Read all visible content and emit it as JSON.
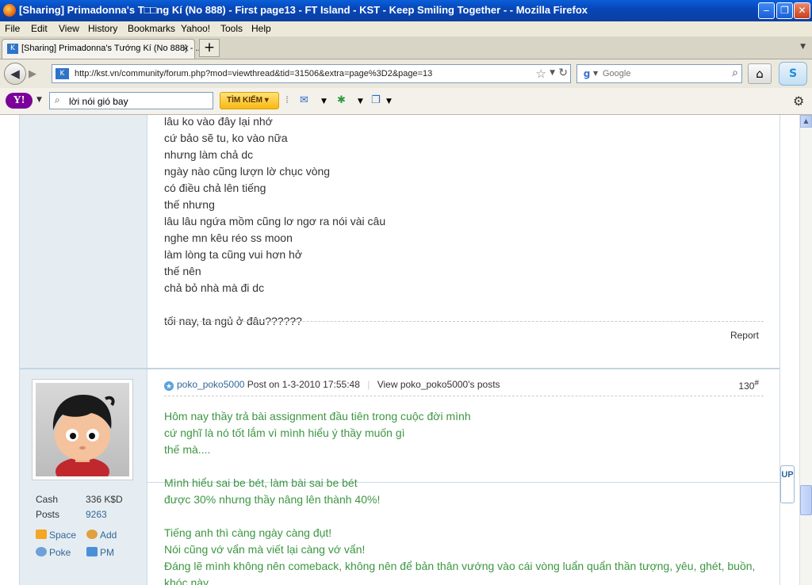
{
  "window": {
    "title": "[Sharing] Primadonna's T□□ng Kí (No 888) - First page13 - FT Island - KST - Keep Smiling Together - - Mozilla Firefox",
    "minimize": "‒",
    "restore": "❐",
    "close": "✕"
  },
  "menu": [
    "File",
    "Edit",
    "View",
    "History",
    "Bookmarks",
    "Yahoo!",
    "Tools",
    "Help"
  ],
  "tab": {
    "label": "[Sharing] Primadonna's Tướng Kí (No 888) - ...",
    "close": "×",
    "new_tab": "+"
  },
  "nav": {
    "url": "http://kst.vn/community/forum.php?mod=viewthread&tid=31506&extra=page%3D2&page=13",
    "search_placeholder": "Google"
  },
  "yahoo": {
    "logo": "Y!",
    "search_value": "lời nói gió bay",
    "search_button": "TÌM KIẾM ▾"
  },
  "post1": {
    "lines": [
      "lâu ko vào đây lại nhớ",
      "cứ bảo sẽ tu, ko vào nữa",
      "nhưng làm chả dc",
      "ngày nào cũng lượn lờ chục vòng",
      "có điều chả lên tiếng",
      "thế nhưng",
      "lâu lâu ngứa mồm cũng lơ ngơ ra nói vài câu",
      "nghe mn kêu réo ss moon",
      "làm lòng ta cũng vui hơn hở",
      "thế nên",
      "chả bỏ nhà mà đi dc",
      "",
      "tối nay, ta ngủ ở đâu??????"
    ],
    "report": "Report"
  },
  "post2": {
    "stats": [
      {
        "label": "Cash",
        "value": "336 K$D"
      },
      {
        "label": "Posts",
        "value": "9263"
      }
    ],
    "actions": {
      "space": "Space",
      "add": "Add",
      "poke": "Poke",
      "pm": "PM"
    },
    "author": "poko_poko5000",
    "posted": "Post on 1-3-2010 17:55:48",
    "view_posts": "View poko_poko5000's posts",
    "number": "130",
    "number_sup": "#",
    "lines": [
      "Hôm nay thầy trả bài assignment đầu tiên trong cuộc đời mình",
      "cứ nghĩ là nó tốt lắm vì mình hiểu ý thầy muốn gì",
      "thế mà....",
      "",
      "Mình hiểu sai be bét, làm bài sai be bét",
      "được 30% nhưng thầy nâng lên thành 40%!",
      "",
      "Tiếng anh thì càng ngày càng đụt!",
      "Nói cũng vớ vẩn mà viết lại càng vớ vẩn!",
      "Đáng lẽ mình không nên comeback, không nên để bản thân vướng vào cái vòng luẩn quẩn thần tượng, yêu, ghét, buồn,",
      "khóc này."
    ]
  },
  "up_tab": "UP",
  "colors": {
    "accent": "#336699",
    "post_text_green": "#3c9642",
    "sidebar_bg": "#e5edf2"
  }
}
